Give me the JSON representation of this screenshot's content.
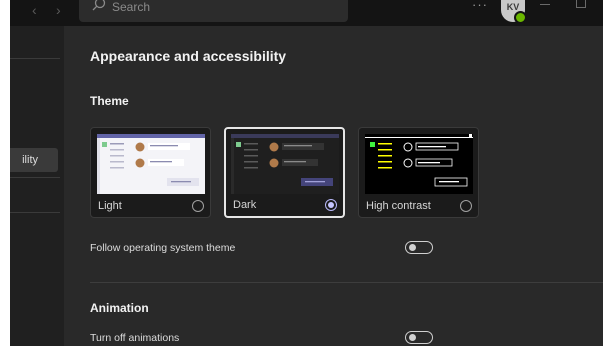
{
  "titlebar": {
    "back_arrow": "‹",
    "forward_arrow": "›",
    "search_placeholder": "Search",
    "more_dots": "···",
    "avatar_initials": "KV"
  },
  "sidebar": {
    "active_item_label": "ility"
  },
  "main": {
    "title": "Appearance and accessibility",
    "theme_heading": "Theme",
    "themes": [
      {
        "label": "Light",
        "selected": false
      },
      {
        "label": "Dark",
        "selected": true
      },
      {
        "label": "High contrast",
        "selected": false
      }
    ],
    "follow_os_label": "Follow operating system theme",
    "follow_os_on": false,
    "animation_heading": "Animation",
    "turn_off_animations_label": "Turn off animations",
    "turn_off_animations_on": false
  },
  "colors": {
    "background": "#292929",
    "accent": "#c5c5ff",
    "status_green": "#6bb700"
  }
}
